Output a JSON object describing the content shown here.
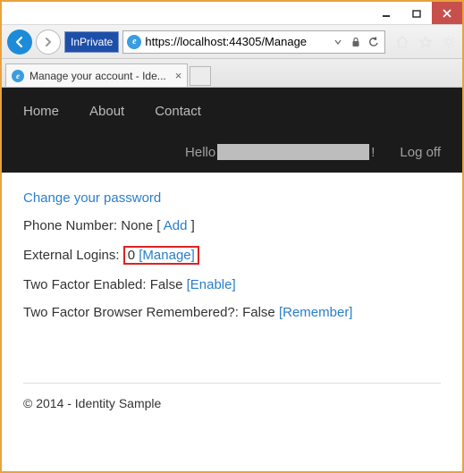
{
  "window": {
    "min_label": "minimize",
    "max_label": "maximize",
    "close_label": "close"
  },
  "addressbar": {
    "inprivate_label": "InPrivate",
    "url": "https://localhost:44305/Manage"
  },
  "tab": {
    "title": "Manage your account - Ide..."
  },
  "nav": {
    "items": [
      "Home",
      "About",
      "Contact"
    ],
    "hello_prefix": "Hello",
    "hello_suffix": "!",
    "logoff": "Log off"
  },
  "content": {
    "change_password": "Change your password",
    "phone_label": "Phone Number:",
    "phone_value": "None",
    "phone_bracket_open": "[",
    "phone_add": "Add",
    "phone_bracket_close": "]",
    "ext_logins_label": "External Logins:",
    "ext_logins_count": "0",
    "ext_logins_manage": "[Manage]",
    "tfe_label": "Two Factor Enabled:",
    "tfe_value": "False",
    "tfe_link": "[Enable]",
    "tfbr_label": "Two Factor Browser Remembered?:",
    "tfbr_value": "False",
    "tfbr_link": "[Remember]"
  },
  "footer": {
    "text": "© 2014 - Identity Sample"
  }
}
